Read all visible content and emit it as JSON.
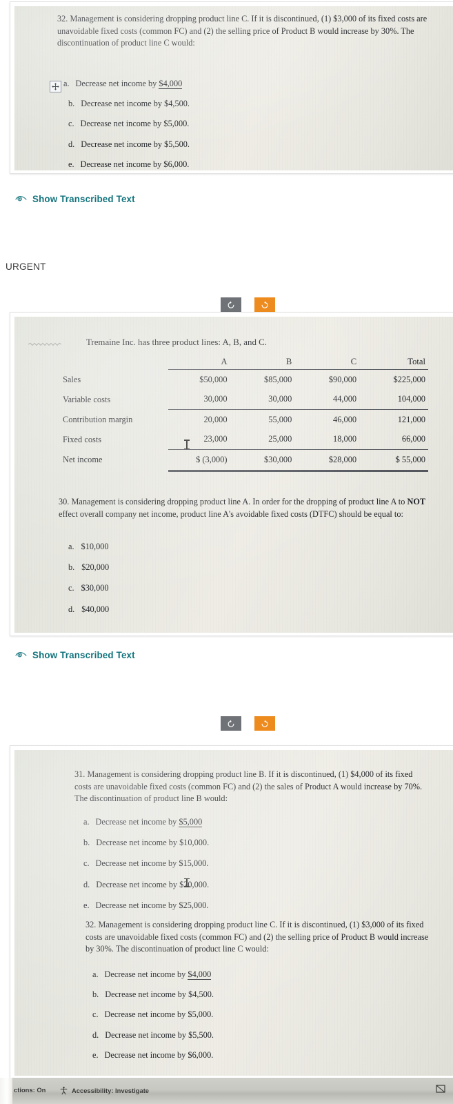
{
  "q32_top": {
    "number": "32.",
    "paragraph": "Management is considering dropping product line C. If it is discontinued, (1) $3,000 of its fixed costs are unavoidable fixed costs (common FC) and (2) the selling price of Product B would increase by 30%. The discontinuation of product line C would:",
    "options": [
      {
        "letter": "a.",
        "text": "Decrease net income by ",
        "value": "$4,000",
        "underlined": true
      },
      {
        "letter": "b.",
        "text": "Decrease net income by ",
        "value": "$4,500.",
        "underlined": false
      },
      {
        "letter": "c.",
        "text": "Decrease net income by ",
        "value": "$5,000.",
        "underlined": false
      },
      {
        "letter": "d.",
        "text": "Decrease net income by ",
        "value": "$5,500.",
        "underlined": false
      },
      {
        "letter": "e.",
        "text": "Decrease net income by ",
        "value": "$6,000.",
        "underlined": false
      }
    ]
  },
  "show_transcribed_1": {
    "label": "Show Transcribed Text",
    "icon": "eye-icon"
  },
  "show_transcribed_2": {
    "label": "Show Transcribed Text",
    "icon": "eye-icon"
  },
  "urgent": {
    "label": "URGENT"
  },
  "rotate_1": {
    "ccw": {
      "label": "rotate-counter-clockwise",
      "icon": "rotate-ccw-icon",
      "color": "#6f7276"
    },
    "cw": {
      "label": "rotate-clockwise",
      "icon": "rotate-cw-icon",
      "color": "#ed8b1f"
    }
  },
  "rotate_2": {
    "ccw": {
      "label": "rotate-counter-clockwise",
      "icon": "rotate-ccw-icon",
      "color": "#6f7276"
    },
    "cw": {
      "label": "rotate-clockwise",
      "icon": "rotate-cw-icon",
      "color": "#ed8b1f"
    }
  },
  "scan2": {
    "caption": "Tremaine Inc. has three product lines: A, B, and C.",
    "table": {
      "columns": [
        "",
        "A",
        "B",
        "C",
        "Total"
      ],
      "rows": [
        {
          "label": "Sales",
          "a": "$50,000",
          "b": "$85,000",
          "c": "$90,000",
          "total": "$225,000"
        },
        {
          "label": "Variable costs",
          "a": "30,000",
          "b": "30,000",
          "c": "44,000",
          "total": "104,000"
        },
        {
          "label": "Contribution margin",
          "a": "20,000",
          "b": "55,000",
          "c": "46,000",
          "total": "121,000"
        },
        {
          "label": "Fixed costs",
          "a": "23,000",
          "b": "25,000",
          "c": "18,000",
          "total": "66,000"
        },
        {
          "label": "Net income",
          "a": "$ (3,000)",
          "b": "$30,000",
          "c": "$28,000",
          "total": "$ 55,000"
        }
      ]
    },
    "q30": {
      "number": "30.",
      "paragraph_part1": "Management is considering dropping product line A. In order for the dropping of product line A to ",
      "paragraph_bold": "NOT",
      "paragraph_part2": " effect overall company net income, product line A's avoidable fixed costs (DTFC) should be equal to:",
      "options": [
        {
          "letter": "a.",
          "text": "$10,000"
        },
        {
          "letter": "b.",
          "text": "$20,000"
        },
        {
          "letter": "c.",
          "text": "$30,000"
        },
        {
          "letter": "d.",
          "text": "$40,000"
        }
      ]
    }
  },
  "scan3": {
    "q31": {
      "number": "31.",
      "paragraph": "Management is considering dropping product line B.  If it is discontinued, (1) $4,000 of its fixed costs are unavoidable fixed costs (common FC) and (2) the sales of Product A would increase by 70%. The discontinuation of product line B would:",
      "options": [
        {
          "letter": "a.",
          "text": "Decrease net income by ",
          "value": "$5,000",
          "underlined": true
        },
        {
          "letter": "b.",
          "text": "Decrease net income by ",
          "value": "$10,000.",
          "underlined": false
        },
        {
          "letter": "c.",
          "text": "Decrease net income by ",
          "value": "$15,000.",
          "underlined": false
        },
        {
          "letter": "d.",
          "text": "Decrease net income by ",
          "value": "$20,000.",
          "underlined": false
        },
        {
          "letter": "e.",
          "text": "Decrease net income by ",
          "value": "$25,000.",
          "underlined": false
        }
      ]
    },
    "q32": {
      "number": "32.",
      "paragraph": "Management is considering dropping product line C. If it is discontinued, (1) $3,000 of its fixed costs are unavoidable fixed costs (common FC) and (2) the selling price of Product B would increase by 30%. The discontinuation of product line C would:",
      "options": [
        {
          "letter": "a.",
          "text": "Decrease net income by ",
          "value": "$4,000",
          "underlined": true
        },
        {
          "letter": "b.",
          "text": "Decrease net income by ",
          "value": "$4,500.",
          "underlined": false
        },
        {
          "letter": "c.",
          "text": "Decrease net income by ",
          "value": "$5,000.",
          "underlined": false
        },
        {
          "letter": "d.",
          "text": "Decrease net income by ",
          "value": "$5,500.",
          "underlined": false
        },
        {
          "letter": "e.",
          "text": "Decrease net income by ",
          "value": "$6,000.",
          "underlined": false
        }
      ]
    }
  },
  "statusbar": {
    "suggestions": "ctions: On",
    "accessibility": "Accessibility: Investigate",
    "accessibility_icon": "accessibility-icon",
    "right_icon": "focus-view-icon"
  }
}
